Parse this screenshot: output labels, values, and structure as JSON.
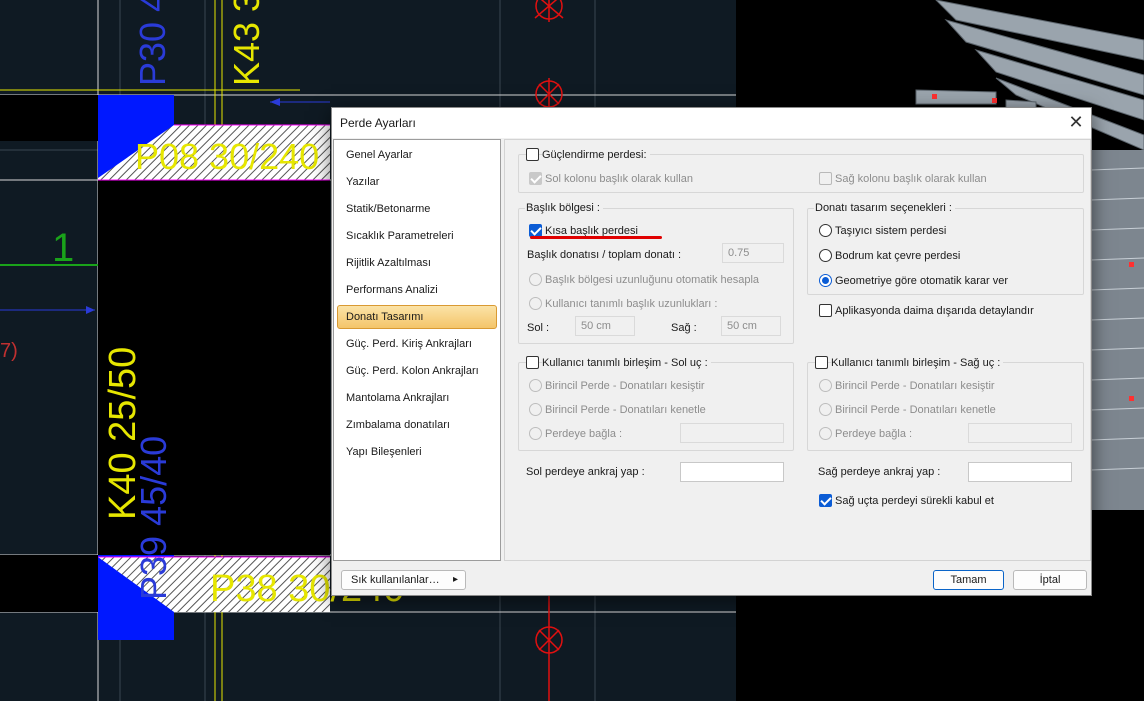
{
  "cad": {
    "labels": [
      "P30 4",
      "K43 3",
      "P08 30/240",
      "1",
      "K40 25/50",
      "P39 45/40",
      "P38 30/240",
      "7)"
    ]
  },
  "dialog": {
    "title": "Perde Ayarları",
    "close_glyph": "✕",
    "nav_items": [
      "Genel Ayarlar",
      "Yazılar",
      "Statik/Betonarme",
      "Sıcaklık Parametreleri",
      "Rijitlik Azaltılması",
      "Performans Analizi",
      "Donatı Tasarımı",
      "Güç. Perd. Kiriş Ankrajları",
      "Güç. Perd. Kolon Ankrajları",
      "Mantolama Ankrajları",
      "Zımbalama donatıları",
      "Yapı Bileşenleri"
    ],
    "selected_nav": "Donatı Tasarımı",
    "strengthen": {
      "label": "Güçlendirme perdesi:",
      "checked": false,
      "left_col": "Sol kolonu başlık olarak kullan",
      "left_col_checked": true,
      "right_col": "Sağ kolonu başlık olarak kullan",
      "right_col_checked": false
    },
    "head_region": {
      "title": "Başlık bölgesi :",
      "short_head": "Kısa başlık perdesi",
      "short_head_checked": true,
      "ratio_label": "Başlık donatısı / toplam donatı :",
      "ratio_value": "0.75",
      "auto_length": "Başlık bölgesi uzunluğunu otomatik hesapla",
      "user_length": "Kullanıcı tanımlı başlık uzunlukları :",
      "left_label": "Sol :",
      "left_value": "50 cm",
      "right_label": "Sağ :",
      "right_value": "50 cm"
    },
    "design_options": {
      "title": "Donatı tasarım seçenekleri :",
      "options": [
        "Taşıyıcı sistem perdesi",
        "Bodrum kat çevre perdesi",
        "Geometriye göre otomatik karar ver"
      ],
      "selected": "Geometriye göre otomatik karar ver",
      "always_outside": "Aplikasyonda daima dışarıda detaylandır",
      "always_outside_checked": false
    },
    "left_join": {
      "title": "Kullanıcı tanımlı birleşim - Sol uç :",
      "checked": false,
      "options": [
        "Birincil Perde - Donatıları kesiştir",
        "Birincil Perde - Donatıları kenetle",
        "Perdeye bağla :"
      ],
      "anchor_label": "Sol perdeye ankraj yap :",
      "anchor_value": ""
    },
    "right_join": {
      "title": "Kullanıcı tanımlı birleşim - Sağ uç :",
      "checked": false,
      "options": [
        "Birincil Perde - Donatıları kesiştir",
        "Birincil Perde - Donatıları kenetle",
        "Perdeye bağla :"
      ],
      "anchor_label": "Sağ perdeye ankraj yap :",
      "anchor_value": "",
      "continuous": "Sağ uçta perdeyi sürekli kabul et",
      "continuous_checked": true
    },
    "footer": {
      "frequent": "Sık kullanılanlar…",
      "frequent_arrow": "▸",
      "ok": "Tamam",
      "cancel": "İptal"
    }
  }
}
